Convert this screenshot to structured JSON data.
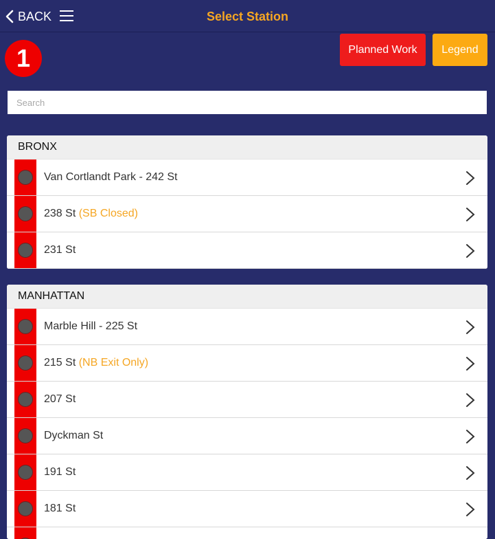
{
  "header": {
    "back_label": "BACK",
    "title": "Select Station"
  },
  "line": {
    "badge": "1",
    "color": "#ee0000"
  },
  "buttons": {
    "planned_work": "Planned Work",
    "legend": "Legend"
  },
  "search": {
    "placeholder": "Search",
    "value": ""
  },
  "sections": [
    {
      "name": "BRONX",
      "stations": [
        {
          "name": "Van Cortlandt Park - 242 St",
          "note": ""
        },
        {
          "name": "238 St",
          "note": "(SB Closed)"
        },
        {
          "name": "231 St",
          "note": ""
        }
      ]
    },
    {
      "name": "MANHATTAN",
      "stations": [
        {
          "name": "Marble Hill - 225 St",
          "note": ""
        },
        {
          "name": "215 St",
          "note": "(NB Exit Only)"
        },
        {
          "name": "207 St",
          "note": ""
        },
        {
          "name": "Dyckman St",
          "note": ""
        },
        {
          "name": "191 St",
          "note": ""
        },
        {
          "name": "181 St",
          "note": ""
        },
        {
          "name": "",
          "note": ""
        }
      ]
    }
  ],
  "colors": {
    "background": "#272c6b",
    "title": "#f5a623",
    "planned_work": "#ee1c1c",
    "legend": "#fcaa12",
    "note": "#f5a623"
  }
}
